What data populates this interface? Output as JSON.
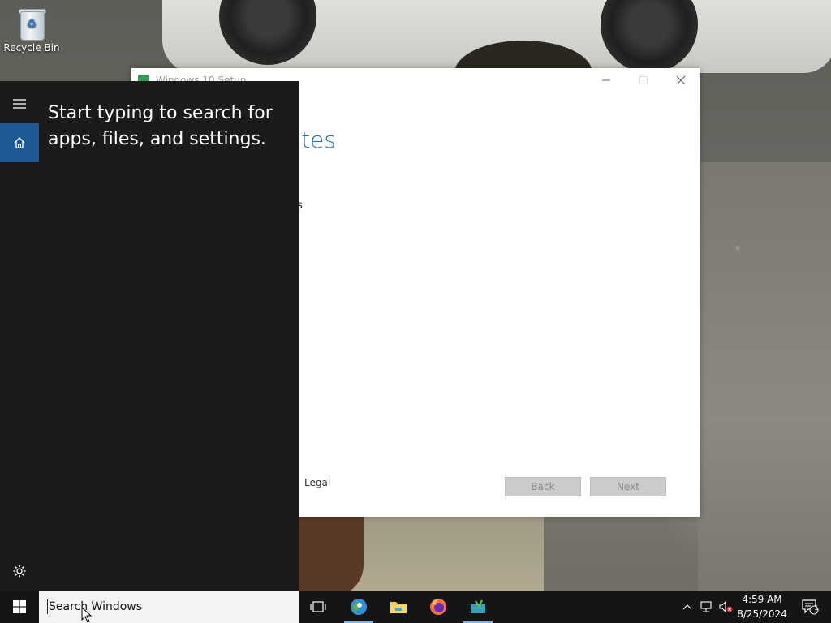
{
  "desktop": {
    "icons": [
      {
        "label": "Recycle Bin",
        "icon": "recycle-bin-icon"
      }
    ]
  },
  "setup_window": {
    "title": "Windows 10 Setup",
    "heading_visible_fragment": "ates",
    "subtext_visible_fragment": "s",
    "legal_link": "Legal",
    "back_button": "Back",
    "next_button": "Next",
    "controls": [
      "minimize-icon",
      "maximize-icon",
      "close-icon"
    ]
  },
  "start_panel": {
    "search_hint": "Start typing to search for apps, files, and settings.",
    "rail": [
      "hamburger-menu-icon",
      "home-icon",
      "settings-gear-icon"
    ],
    "accent": "#1e5a96"
  },
  "taskbar": {
    "search_placeholder": "Search Windows",
    "apps": [
      {
        "name": "task-view-icon",
        "active": false
      },
      {
        "name": "browser-globe-icon",
        "active": true
      },
      {
        "name": "file-explorer-icon",
        "active": false
      },
      {
        "name": "firefox-icon",
        "active": false
      },
      {
        "name": "windows-setup-icon",
        "active": true
      }
    ],
    "tray": [
      "chevron-up-icon",
      "network-icon",
      "volume-muted-icon"
    ],
    "time": "4:59 AM",
    "date": "8/25/2024",
    "notification_count": "1"
  }
}
